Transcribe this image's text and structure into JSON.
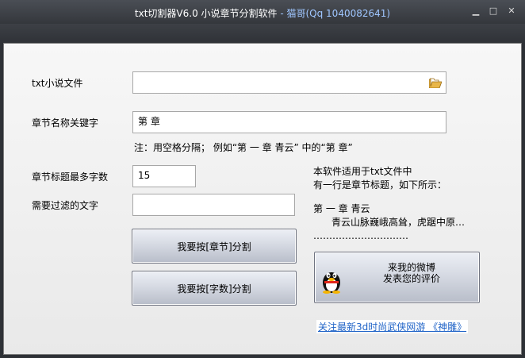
{
  "window": {
    "title_main": "txt切割器V6.0 小说章节分割软件",
    "title_accent": " - 猫哥(Qq 1040082641)",
    "controls": {
      "minimize": "▁",
      "maximize": "□",
      "close": "✕"
    }
  },
  "form": {
    "txt_file_label": "txt小说文件",
    "txt_file_value": "",
    "chapter_keyword_label": "章节名称关键字",
    "chapter_keyword_value": "第 章",
    "keyword_hint": "注：用空格分隔；    例如“第 一 章   青云” 中的“第 章”",
    "max_title_length_label": "章节标题最多字数",
    "max_title_length_value": "15",
    "filter_text_label": "需要过滤的文字",
    "filter_text_value": ""
  },
  "buttons": {
    "split_by_chapter": "我要按[章节]分割",
    "split_by_words": "我要按[字数]分割"
  },
  "info": {
    "line1": "本软件适用于txt文件中",
    "line2": "有一行是章节标题，如下所示：",
    "example_title": "第 一 章   青云",
    "example_body": "青云山脉巍峨高耸，虎踞中原…",
    "dots": "…………………………"
  },
  "weibo": {
    "line1": "来我的微博",
    "line2": "发表您的评价"
  },
  "link_text": "关注最新3d时尚武侠网游 《神雕》"
}
